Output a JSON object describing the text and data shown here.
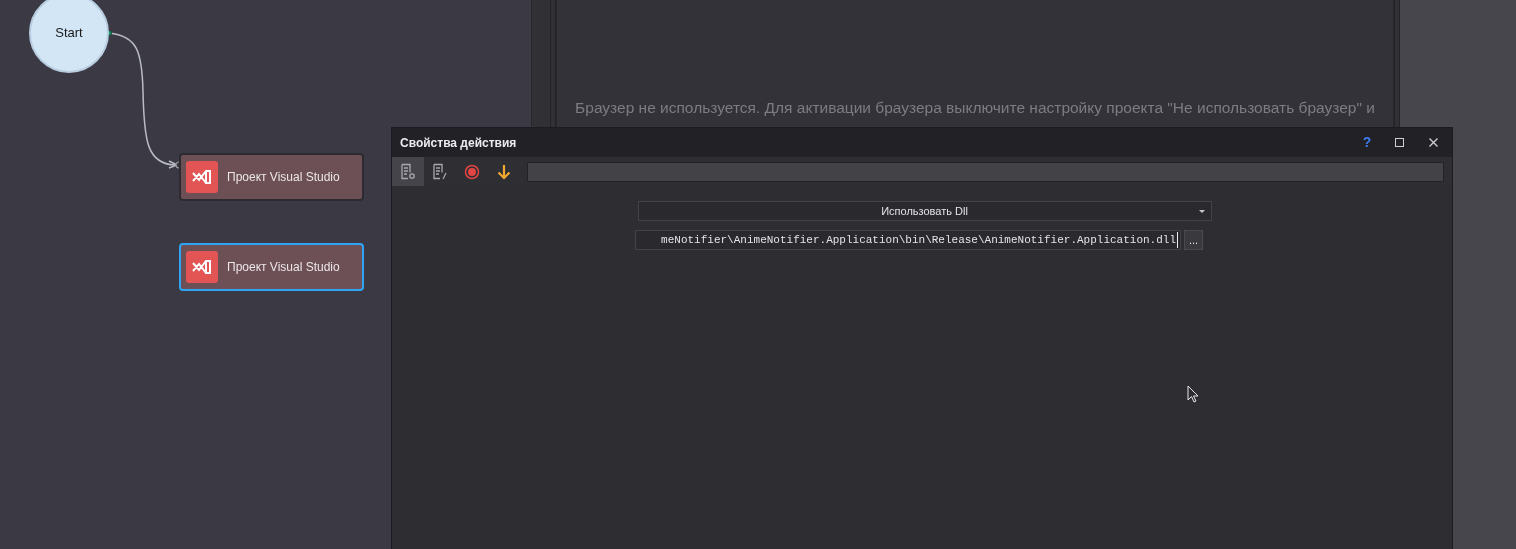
{
  "canvas": {
    "nodes": [
      {
        "kind": "start",
        "label": "Start",
        "selected": false
      },
      {
        "kind": "action",
        "label": "Проект Visual Studio",
        "selected": false
      },
      {
        "kind": "action",
        "label": "Проект Visual Studio",
        "selected": true
      }
    ]
  },
  "browser_panel": {
    "message": "Браузер не используется. Для активации браузера выключите настройку проекта \"Не использовать браузер\" и"
  },
  "dialog": {
    "title": "Свойства действия",
    "help": "?",
    "toolbar": [
      {
        "kind": "properties",
        "selected": true
      },
      {
        "kind": "edit",
        "selected": false
      },
      {
        "kind": "record",
        "selected": false
      },
      {
        "kind": "download",
        "selected": false
      }
    ],
    "mode_select": {
      "value": "Использовать Dll"
    },
    "path_field": {
      "value": "meNotifier\\AnimeNotifier.Application\\bin\\Release\\AnimeNotifier.Application.dll"
    },
    "browse_button": "..."
  }
}
